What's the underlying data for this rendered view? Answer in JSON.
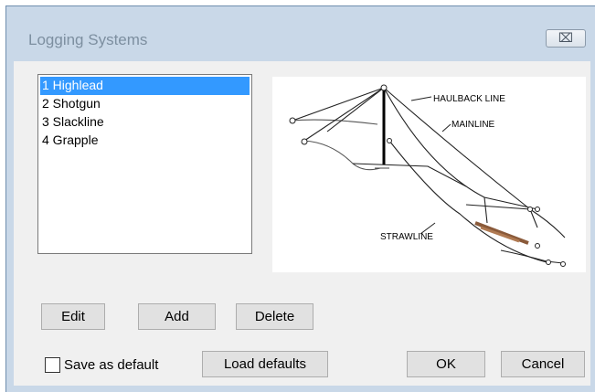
{
  "window": {
    "title": "Logging Systems",
    "close_glyph": "⌧"
  },
  "systems_list": {
    "items": [
      "1 Highlead",
      "2 Shotgun",
      "3 Slackline",
      "4 Grapple"
    ],
    "selected_index": 0
  },
  "diagram": {
    "labels": {
      "haulback": "HAULBACK LINE",
      "mainline": "MAINLINE",
      "strawline": "STRAWLINE"
    }
  },
  "buttons": {
    "edit": "Edit",
    "add": "Add",
    "delete": "Delete",
    "load_defaults": "Load defaults",
    "ok": "OK",
    "cancel": "Cancel"
  },
  "save_default": {
    "label": "Save as default",
    "checked": false
  }
}
